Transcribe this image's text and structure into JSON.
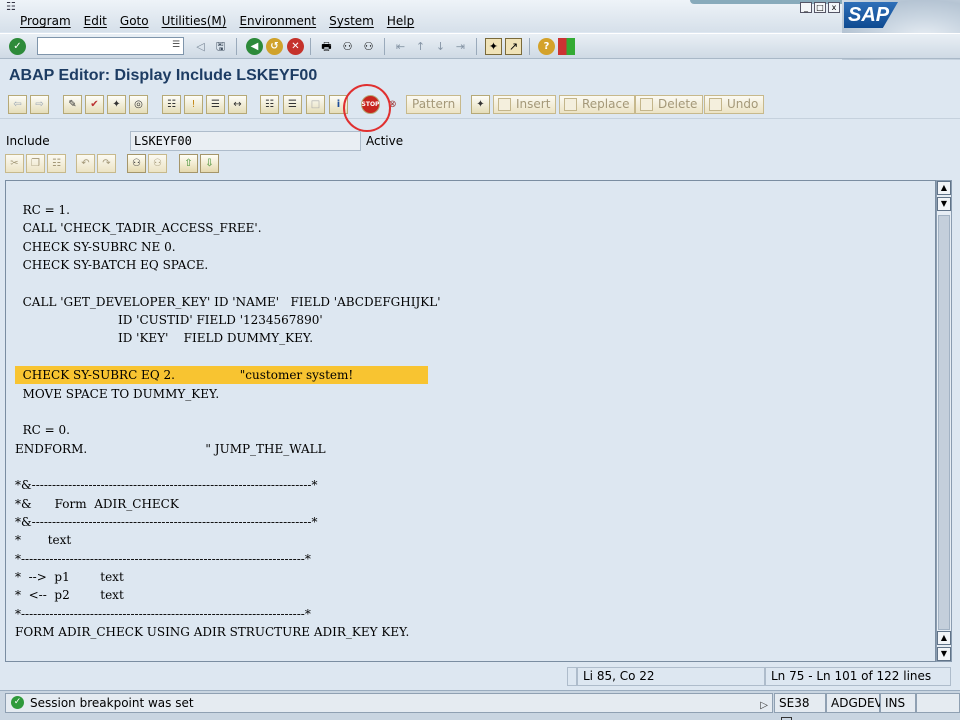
{
  "menu": {
    "items": [
      "Program",
      "Edit",
      "Goto",
      "Utilities(M)",
      "Environment",
      "System",
      "Help"
    ]
  },
  "sap_logo_text": "SAP",
  "system_toolbar": {
    "command_field_value": ""
  },
  "title": "ABAP Editor: Display Include LSKEYF00",
  "app_toolbar": {
    "pattern_label": "Pattern",
    "insert_label": "Insert",
    "replace_label": "Replace",
    "delete_label": "Delete",
    "undo_label": "Undo"
  },
  "include": {
    "label": "Include",
    "value": "LSKEYF00",
    "status": "Active"
  },
  "code_lines": [
    "  RC = 1.",
    "  CALL 'CHECK_TADIR_ACCESS_FREE'.",
    "  CHECK SY-SUBRC NE 0.",
    "  CHECK SY-BATCH EQ SPACE.",
    "",
    "  CALL 'GET_DEVELOPER_KEY' ID 'NAME'   FIELD 'ABCDEFGHIJKL'",
    "                           ID 'CUSTID' FIELD '1234567890'",
    "                           ID 'KEY'    FIELD DUMMY_KEY.",
    "",
    "  CHECK SY-SUBRC EQ 2.                 \"customer system!",
    "  MOVE SPACE TO DUMMY_KEY.",
    "",
    "  RC = 0.",
    "ENDFORM.                               \" JUMP_THE_WALL",
    "",
    "*&---------------------------------------------------------------------*",
    "*&      Form  ADIR_CHECK",
    "*&---------------------------------------------------------------------*",
    "*       text",
    "*----------------------------------------------------------------------*",
    "*  -->  p1        text",
    "*  <--  p2        text",
    "*----------------------------------------------------------------------*",
    "FORM ADIR_CHECK USING ADIR STRUCTURE ADIR_KEY KEY."
  ],
  "highlighted_line_index": 9,
  "position": {
    "cursor": "Li 85, Co 22",
    "range": "Ln 75 - Ln 101 of 122 lines"
  },
  "status": {
    "message": "Session breakpoint was set",
    "transaction": "SE38",
    "system": "ADGDEV",
    "mode": "INS"
  }
}
